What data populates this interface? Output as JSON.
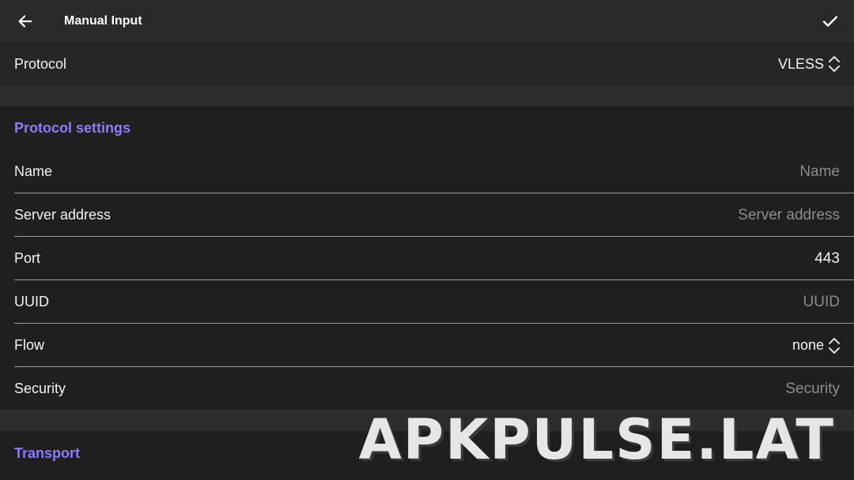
{
  "header": {
    "title": "Manual Input",
    "back_icon": "arrow-left-icon",
    "confirm_icon": "check-icon"
  },
  "protocol": {
    "label": "Protocol",
    "value": "VLESS",
    "icon": "chevron-up-down-icon"
  },
  "sections": {
    "protocol_settings": "Protocol settings",
    "transport": "Transport"
  },
  "fields": {
    "name": {
      "label": "Name",
      "placeholder": "Name"
    },
    "server_address": {
      "label": "Server address",
      "placeholder": "Server address"
    },
    "port": {
      "label": "Port",
      "value": "443"
    },
    "uuid": {
      "label": "UUID",
      "placeholder": "UUID"
    },
    "flow": {
      "label": "Flow",
      "value": "none"
    },
    "security": {
      "label": "Security",
      "placeholder": "Security"
    }
  },
  "watermark": "APKPULSE.LAT",
  "colors": {
    "accent": "#8a7cff",
    "background": "#1f1f1f",
    "toolbar": "#2a2a2a",
    "placeholder": "#8c8c8c"
  }
}
